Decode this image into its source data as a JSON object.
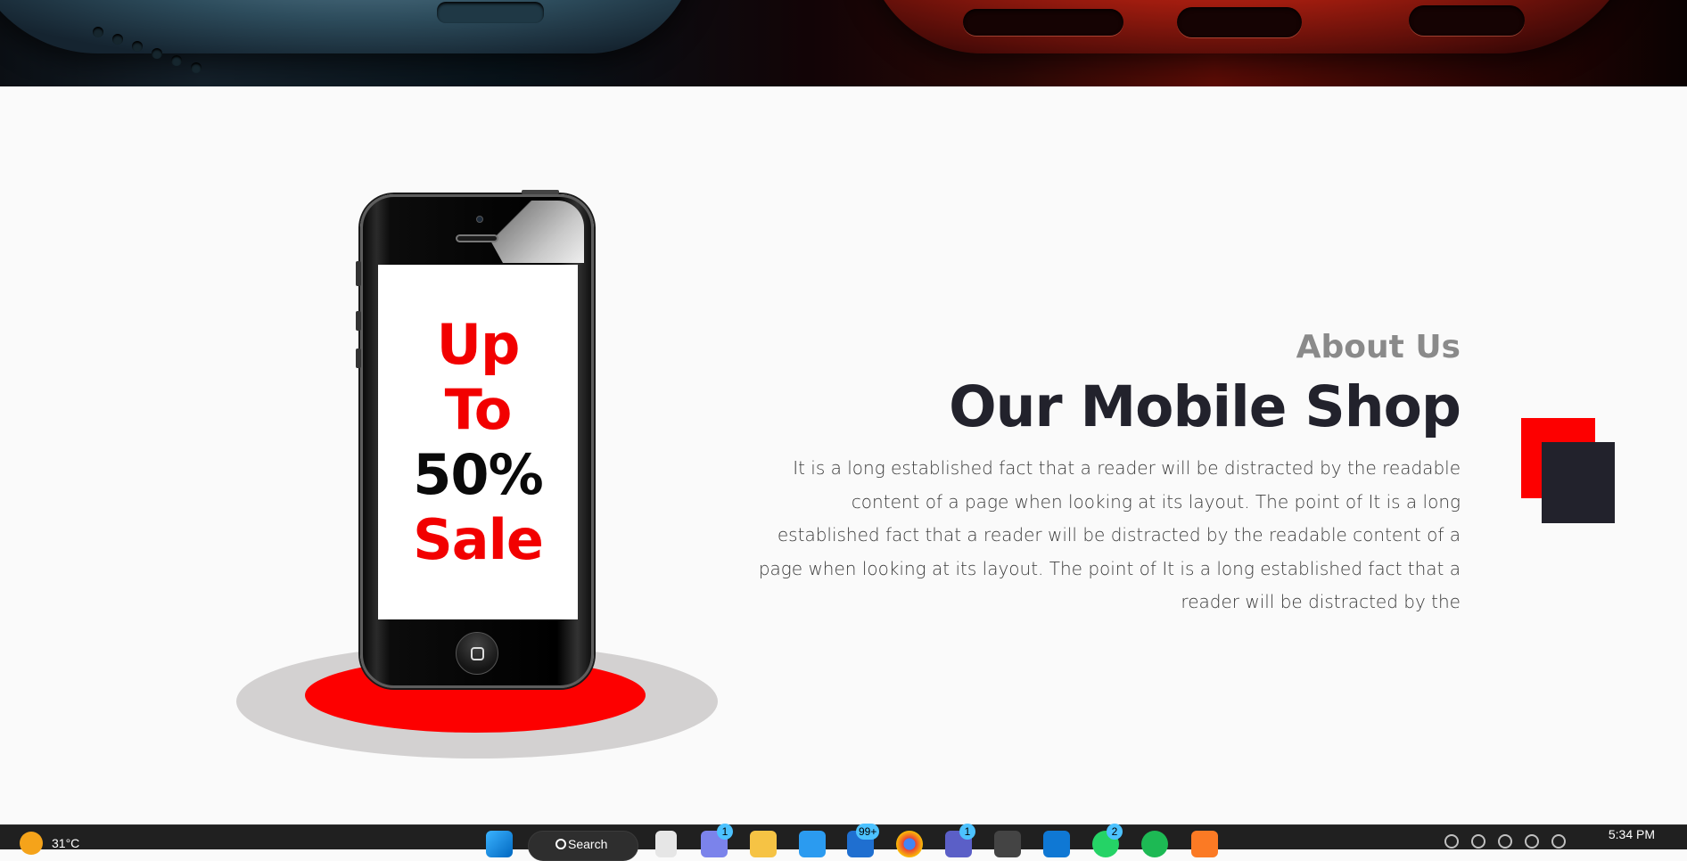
{
  "about": {
    "subtitle": "About Us",
    "title": "Our Mobile Shop",
    "body": "It is a long established fact that a reader will be distracted by the readable content of a page when looking at its layout. The point of It is a long established fact that a reader will be distracted by the readable content of a page when looking at its layout. The point of It is a long established fact that a reader will be distracted by the"
  },
  "phone_screen": {
    "line1": "Up",
    "line2": "To",
    "line3": "50%",
    "line4": "Sale"
  },
  "taskbar": {
    "weather": "31°C",
    "search_label": "Search",
    "badges": {
      "teams": "1",
      "mail": "99+",
      "chat": "1",
      "whatsapp": "2"
    },
    "clock": "5:34 PM"
  },
  "colors": {
    "accent": "#fd0000",
    "dark": "#22222c",
    "stage": "#d3d1d1",
    "taskbar": "#202020"
  },
  "icons": [
    "start-icon",
    "search-icon",
    "file-icon",
    "teams-icon",
    "folder-icon",
    "vscode-icon",
    "mail-icon",
    "chrome-icon",
    "chat-icon",
    "terminal-icon",
    "onedrive-icon",
    "whatsapp-icon",
    "spotify-icon",
    "xampp-icon"
  ]
}
